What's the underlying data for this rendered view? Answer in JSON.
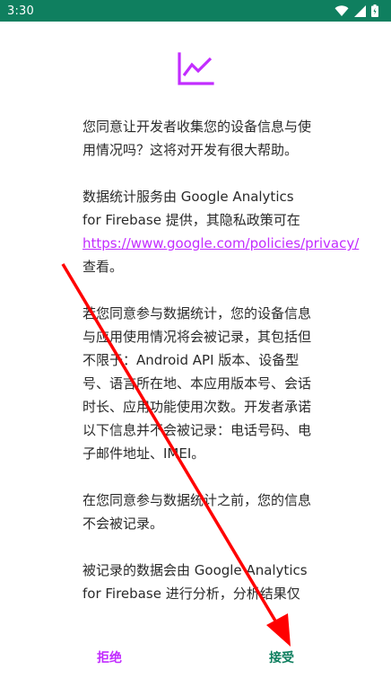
{
  "status_bar": {
    "time": "3:30",
    "colors": {
      "background": "#0f7f5f"
    },
    "icons": [
      "wifi-icon",
      "signal-icon",
      "battery-icon"
    ]
  },
  "dialog": {
    "paragraph1": "您同意让开发者收集您的设备信息与使用情况吗？这将对开发有很大帮助。",
    "paragraph2_prefix": "数据统计服务由 Google Analytics for Firebase 提供，其隐私政策可在",
    "paragraph2_link": "https://www.google.com/policies/privacy/",
    "paragraph2_suffix": "查看。",
    "paragraph3": "若您同意参与数据统计，您的设备信息与应用使用情况将会被记录，其包括但不限于：Android API 版本、设备型号、语言所在地、本应用版本号、会话时长、应用功能使用次数。开发者承诺以下信息并不会被记录：电话号码、电子邮件地址、IMEI。",
    "paragraph4": "在您同意参与数据统计之前，您的信息不会被记录。",
    "paragraph5": "被记录的数据会由 Google Analytics for Firebase 进行分析，分析结果仅"
  },
  "buttons": {
    "decline": "拒绝",
    "accept": "接受"
  },
  "colors": {
    "accent": "#c22cff",
    "primary": "#0f7f5f",
    "annotation_arrow": "#ff0000"
  }
}
